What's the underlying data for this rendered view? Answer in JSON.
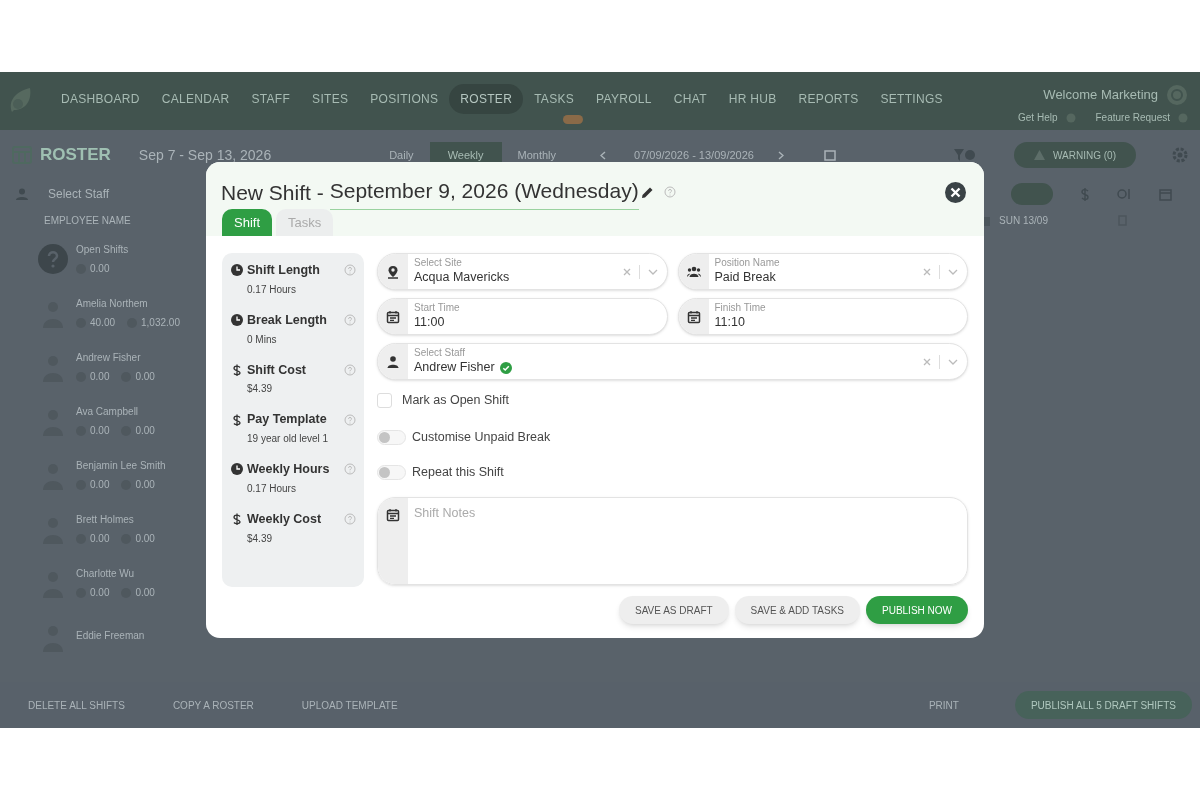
{
  "nav": {
    "items": [
      {
        "label": "DASHBOARD",
        "selected": false
      },
      {
        "label": "CALENDAR",
        "selected": false
      },
      {
        "label": "STAFF",
        "selected": false
      },
      {
        "label": "SITES",
        "selected": false
      },
      {
        "label": "POSITIONS",
        "selected": false
      },
      {
        "label": "ROSTER",
        "selected": true
      },
      {
        "label": "TASKS",
        "selected": false,
        "badge": true
      },
      {
        "label": "PAYROLL",
        "selected": false
      },
      {
        "label": "CHAT",
        "selected": false
      },
      {
        "label": "HR HUB",
        "selected": false
      },
      {
        "label": "REPORTS",
        "selected": false
      },
      {
        "label": "SETTINGS",
        "selected": false
      }
    ],
    "welcome": "Welcome Marketing",
    "links": [
      "Get Help",
      "Feature Request"
    ]
  },
  "roster": {
    "title": "ROSTER",
    "range": "Sep 7 - Sep 13, 2026",
    "views": [
      {
        "label": "Daily",
        "selected": false
      },
      {
        "label": "Weekly",
        "selected": true
      },
      {
        "label": "Monthly",
        "selected": false
      }
    ],
    "date_range": "07/09/2026 - 13/09/2026",
    "warning": "WARNING (0)"
  },
  "staff_search": {
    "placeholder": "Select Staff"
  },
  "columns": {
    "employee": "EMPLOYEE NAME",
    "day": "SUN 13/09"
  },
  "employees": [
    {
      "kind": "open",
      "name": "Open Shifts",
      "hours": "0.00"
    },
    {
      "kind": "staff",
      "name": "Amelia Northem",
      "hours": "40.00",
      "cost": "1,032.00"
    },
    {
      "kind": "staff",
      "name": "Andrew Fisher",
      "hours": "0.00",
      "cost": "0.00"
    },
    {
      "kind": "staff",
      "name": "Ava Campbell",
      "hours": "0.00",
      "cost": "0.00"
    },
    {
      "kind": "staff",
      "name": "Benjamin Lee Smith",
      "hours": "0.00",
      "cost": "0.00"
    },
    {
      "kind": "staff",
      "name": "Brett Holmes",
      "hours": "0.00",
      "cost": "0.00"
    },
    {
      "kind": "staff",
      "name": "Charlotte Wu",
      "hours": "0.00",
      "cost": "0.00"
    },
    {
      "kind": "staff",
      "name": "Eddie Freeman"
    }
  ],
  "footer": {
    "actions": [
      "DELETE ALL SHIFTS",
      "COPY A ROSTER",
      "UPLOAD TEMPLATE"
    ],
    "print": "PRINT",
    "publish": "PUBLISH ALL 5 DRAFT SHIFTS"
  },
  "modal": {
    "title": "New Shift -",
    "date": "September 9, 2026 (Wednesday)",
    "tabs": [
      {
        "label": "Shift",
        "selected": true
      },
      {
        "label": "Tasks",
        "selected": false
      }
    ],
    "summary": [
      {
        "kind": "time",
        "label": "Shift Length",
        "value": "0.17 Hours"
      },
      {
        "kind": "time",
        "label": "Break Length",
        "value": "0 Mins"
      },
      {
        "kind": "money",
        "label": "Shift Cost",
        "value": "$4.39"
      },
      {
        "kind": "money",
        "label": "Pay Template",
        "value": "19 year old level 1"
      },
      {
        "kind": "time",
        "label": "Weekly Hours",
        "value": "0.17 Hours"
      },
      {
        "kind": "money",
        "label": "Weekly Cost",
        "value": "$4.39"
      }
    ],
    "fields": [
      {
        "kind": "select",
        "label": "Select Site",
        "value": "Acqua Mavericks"
      },
      {
        "kind": "select",
        "label": "Position Name",
        "value": "Paid Break"
      },
      {
        "kind": "time",
        "label": "Start Time",
        "value": "11:00"
      },
      {
        "kind": "time",
        "label": "Finish Time",
        "value": "11:10"
      }
    ],
    "staff": {
      "kind": "select",
      "label": "Select Staff",
      "value": "Andrew Fisher",
      "verified": true
    },
    "open_shift": {
      "label": "Mark as Open Shift",
      "checked": false
    },
    "toggles": [
      {
        "label": "Customise Unpaid Break",
        "on": false
      },
      {
        "label": "Repeat this Shift",
        "on": false
      }
    ],
    "notes": {
      "placeholder": "Shift Notes"
    },
    "buttons": [
      {
        "kind": "secondary",
        "label": "SAVE AS DRAFT"
      },
      {
        "kind": "secondary",
        "label": "SAVE & ADD TASKS"
      },
      {
        "kind": "primary",
        "label": "PUBLISH NOW"
      }
    ]
  }
}
